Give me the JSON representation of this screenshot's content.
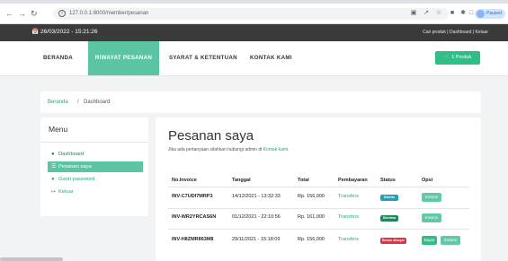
{
  "browser": {
    "url": "127.0.0.1:8000/member/pesanan",
    "profile_label": "Paused"
  },
  "topbar": {
    "datetime": "26/03/2022 - 15:21:26",
    "links": "Cari produk  |  Dashboard  |  Keluar"
  },
  "nav": {
    "items": [
      "BERANDA",
      "RIWAYAT PESANAN",
      "SYARAT & KETENTUAN",
      "KONTAK KAMI"
    ],
    "active_index": 1,
    "cart_label": "1 Produk"
  },
  "breadcrumb": {
    "home": "Beranda",
    "separator": "/",
    "current": "Dashboard"
  },
  "sidebar": {
    "title": "Menu",
    "items": [
      {
        "icon": "dashboard-icon",
        "label": "Dashboard"
      },
      {
        "icon": "list-icon",
        "label": "Pesanan saya"
      },
      {
        "icon": "lock-icon",
        "label": "Ganti password"
      },
      {
        "icon": "logout-icon",
        "label": "Keluar"
      }
    ],
    "active_index": 1
  },
  "main": {
    "title": "Pesanan saya",
    "subtitle_text": "Jika ada pertanyaan silahkan hubungi admin di",
    "subtitle_link": "Kontak kami.",
    "table": {
      "headers": [
        "No.Invoice",
        "Tanggal",
        "Total",
        "Pembayaran",
        "Status",
        "Opsi"
      ],
      "rows": [
        {
          "invoice": "INV-C7UDI7MRP3",
          "date": "14/12/2021 - 13:32:33",
          "total": "Rp. 156,000",
          "payment": "Transfers",
          "status": "Dikirim",
          "status_color": "#21a0b8",
          "actions": [
            "Invoice"
          ]
        },
        {
          "invoice": "INV-WR2YRCAS6N",
          "date": "01/12/2021 - 22:10:56",
          "total": "Rp. 161,000",
          "payment": "Transfers",
          "status": "Diterima",
          "status_color": "#20875b",
          "actions": [
            "Invoice"
          ]
        },
        {
          "invoice": "INV-H8ZMR863M8",
          "date": "29/11/2021 - 15:18:09",
          "total": "Rp. 156,000",
          "payment": "Transfers",
          "status": "Belum dibayar",
          "status_color": "#dc3545",
          "actions": [
            "Bayar",
            "Invoice"
          ]
        }
      ]
    }
  },
  "colors": {
    "accent": "#5bc4a5",
    "dark_bar": "#3a3a3a",
    "link": "#2aa67c"
  }
}
